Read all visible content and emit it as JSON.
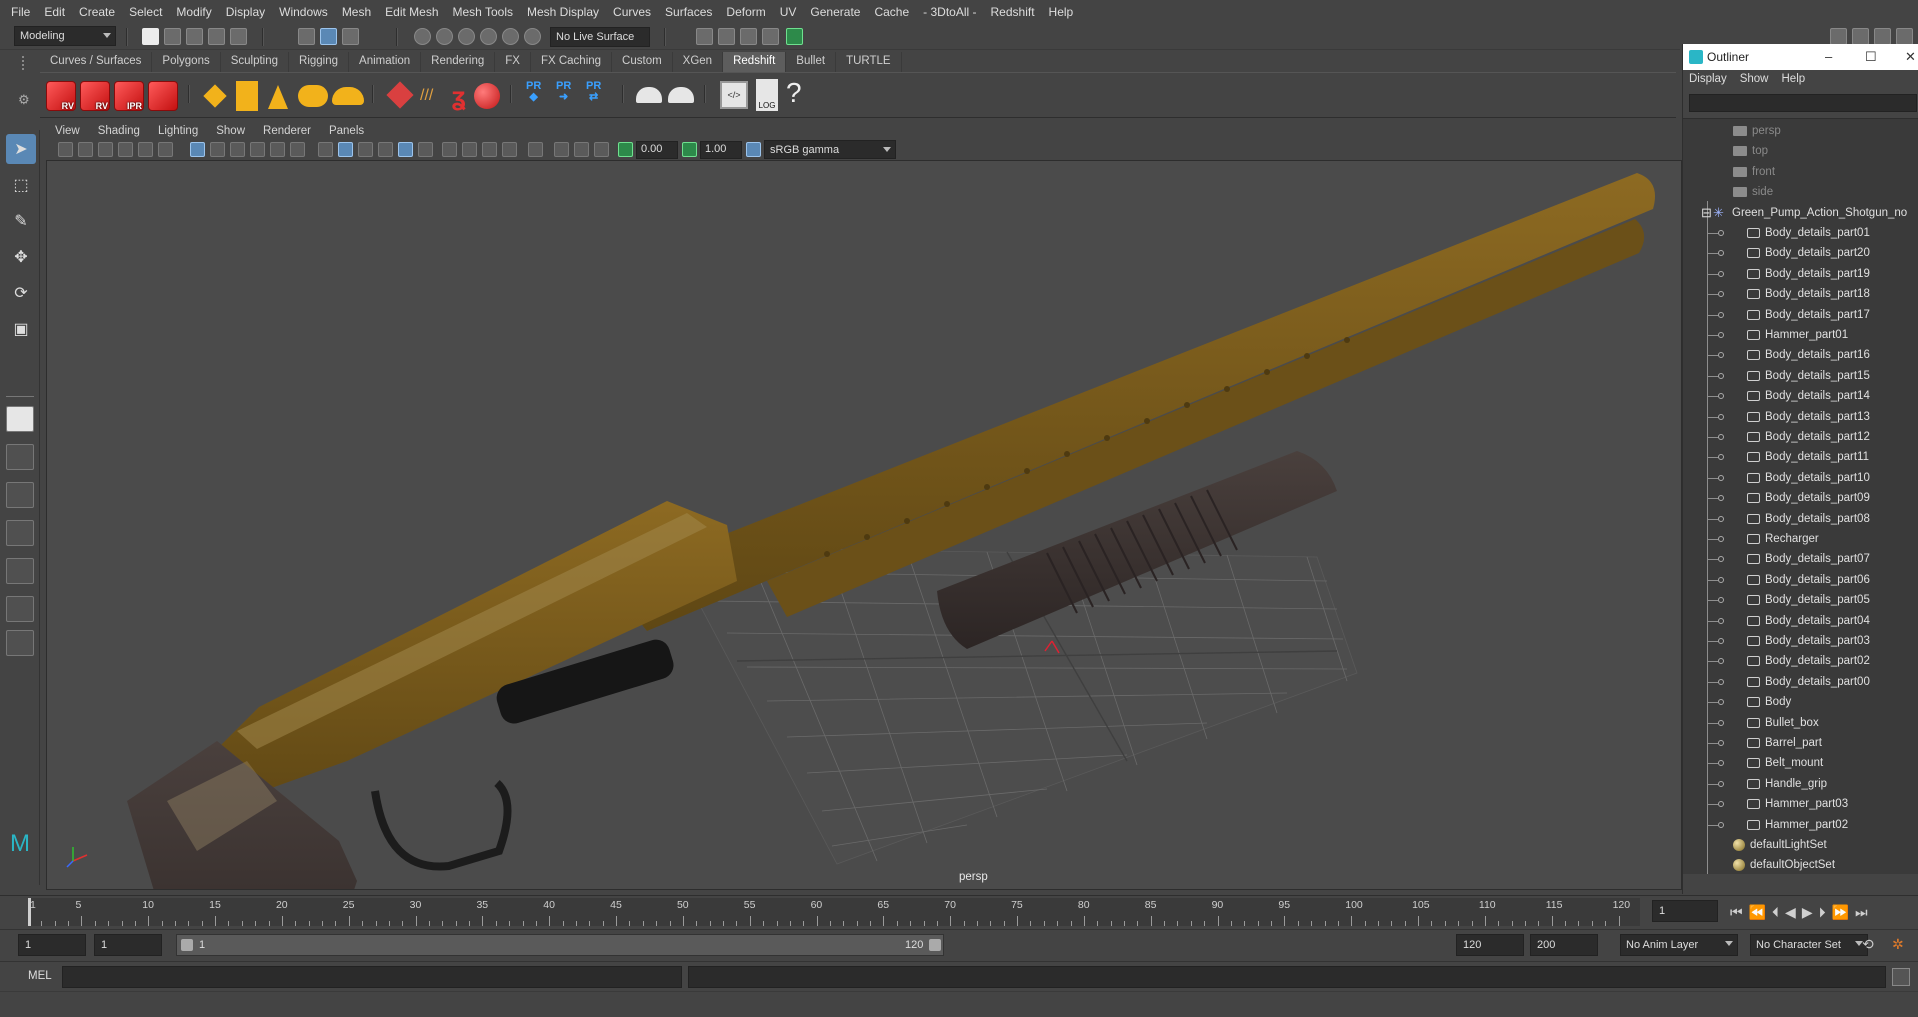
{
  "menubar": {
    "items": [
      "File",
      "Edit",
      "Create",
      "Select",
      "Modify",
      "Display",
      "Windows",
      "Mesh",
      "Edit Mesh",
      "Mesh Tools",
      "Mesh Display",
      "Curves",
      "Surfaces",
      "Deform",
      "UV",
      "Generate",
      "Cache",
      "- 3DtoAll -",
      "Redshift",
      "Help"
    ]
  },
  "statusline": {
    "mode": "Modeling",
    "live_surface": "No Live Surface"
  },
  "shelf": {
    "tabs": [
      "Curves / Surfaces",
      "Polygons",
      "Sculpting",
      "Rigging",
      "Animation",
      "Rendering",
      "FX",
      "FX Caching",
      "Custom",
      "XGen",
      "Redshift",
      "Bullet",
      "TURTLE"
    ],
    "active_tab": "Redshift",
    "cube_labels": [
      "RV",
      "RV",
      "IPR",
      ""
    ],
    "pr_labels": [
      "PR",
      "PR",
      "PR"
    ],
    "log_label": "LOG",
    "help_glyph": "?"
  },
  "panel": {
    "menus": [
      "View",
      "Shading",
      "Lighting",
      "Show",
      "Renderer",
      "Panels"
    ],
    "exposure": "0.00",
    "gamma": "1.00",
    "colorspace": "sRGB gamma",
    "camera": "persp"
  },
  "outliner": {
    "title": "Outliner",
    "menus": [
      "Display",
      "Show",
      "Help"
    ],
    "cameras": [
      "persp",
      "top",
      "front",
      "side"
    ],
    "group": "Green_Pump_Action_Shotgun_no",
    "children": [
      "Body_details_part01",
      "Body_details_part20",
      "Body_details_part19",
      "Body_details_part18",
      "Body_details_part17",
      "Hammer_part01",
      "Body_details_part16",
      "Body_details_part15",
      "Body_details_part14",
      "Body_details_part13",
      "Body_details_part12",
      "Body_details_part11",
      "Body_details_part10",
      "Body_details_part09",
      "Body_details_part08",
      "Recharger",
      "Body_details_part07",
      "Body_details_part06",
      "Body_details_part05",
      "Body_details_part04",
      "Body_details_part03",
      "Body_details_part02",
      "Body_details_part00",
      "Body",
      "Bullet_box",
      "Barrel_part",
      "Belt_mount",
      "Handle_grip",
      "Hammer_part03",
      "Hammer_part02"
    ],
    "sets": [
      "defaultLightSet",
      "defaultObjectSet"
    ]
  },
  "timeline": {
    "ticks": [
      5,
      10,
      15,
      20,
      25,
      30,
      35,
      40,
      45,
      50,
      55,
      60,
      65,
      70,
      75,
      80,
      85,
      90,
      95,
      100,
      105,
      110,
      115,
      120
    ],
    "first_label": "1",
    "current_frame": "1"
  },
  "range": {
    "start": "1",
    "playback_start": "1",
    "slider_start": "1",
    "slider_end": "120",
    "playback_end": "120",
    "end": "200",
    "anim_layer": "No Anim Layer",
    "character_set": "No Character Set"
  },
  "cmdline": {
    "label": "MEL"
  },
  "colors": {
    "accent": "#5a88b5",
    "gun_body": "#7a5c1c",
    "gun_dark": "#3d3533",
    "viewport_bg": "#4b4b4b"
  }
}
